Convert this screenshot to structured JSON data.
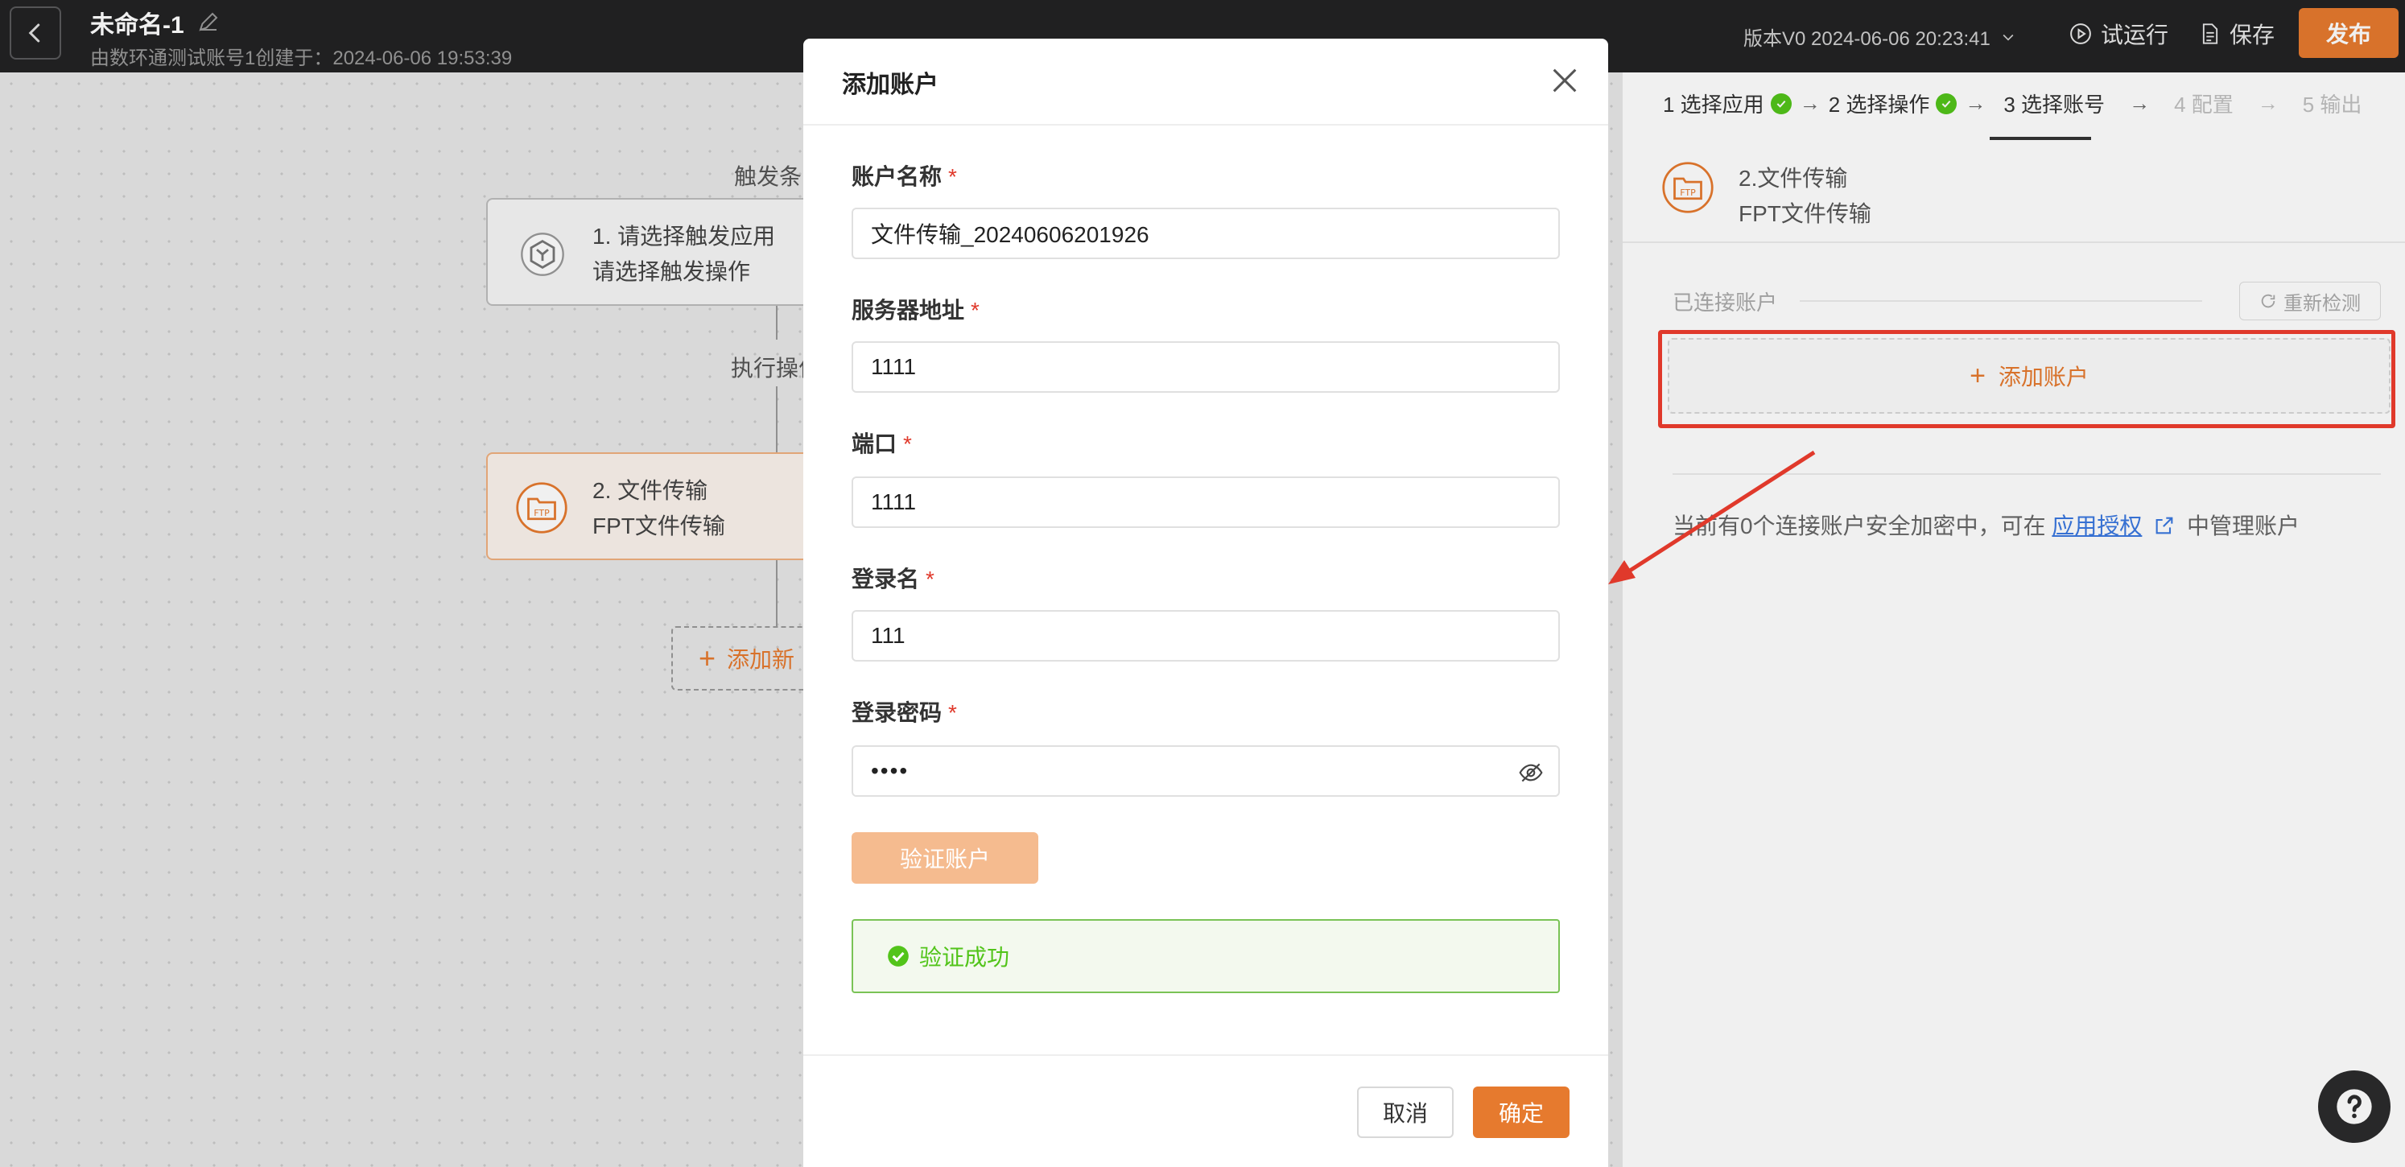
{
  "topbar": {
    "title": "未命名-1",
    "subtitle": "由数环通测试账号1创建于：2024-06-06 19:53:39",
    "version": "版本V0 2024-06-06 20:23:41",
    "run_label": "试运行",
    "save_label": "保存",
    "publish_label": "发布"
  },
  "canvas": {
    "trigger_label": "触发条",
    "action_label": "执行操作",
    "trigger_node": {
      "line1": "1. 请选择触发应用",
      "line2": "请选择触发操作"
    },
    "action_node": {
      "line1": "2. 文件传输",
      "line2": "FPT文件传输"
    },
    "add_node_label": "添加新"
  },
  "panel": {
    "steps": [
      {
        "label": "1 选择应用",
        "done": true
      },
      {
        "label": "2 选择操作",
        "done": true
      },
      {
        "label": "3 选择账号",
        "active": true
      },
      {
        "label": "4 配置",
        "muted": true
      },
      {
        "label": "5 输出",
        "muted": true
      }
    ],
    "app_title": "2.文件传输",
    "app_subtitle": "FPT文件传输",
    "section_title": "已连接账户",
    "recheck_label": "重新检测",
    "add_account_label": "添加账户",
    "hint_prefix": "当前有0个连接账户安全加密中，可在",
    "hint_link": "应用授权",
    "hint_suffix": "中管理账户"
  },
  "modal": {
    "title": "添加账户",
    "fields": [
      {
        "label": "账户名称",
        "value": "文件传输_20240606201926"
      },
      {
        "label": "服务器地址",
        "value": "1111"
      },
      {
        "label": "端口",
        "value": "1111"
      },
      {
        "label": "登录名",
        "value": "111"
      },
      {
        "label": "登录密码",
        "value": "••••"
      }
    ],
    "verify_label": "验证账户",
    "success_text": "验证成功",
    "cancel_label": "取消",
    "confirm_label": "确定"
  },
  "colors": {
    "accent": "#e67a2e",
    "success": "#52c41a",
    "danger": "#e0392b",
    "topbar": "#232324"
  }
}
